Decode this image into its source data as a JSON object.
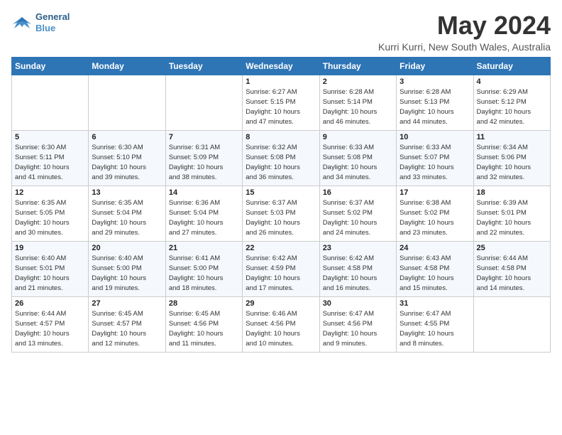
{
  "logo": {
    "line1": "General",
    "line2": "Blue"
  },
  "title": "May 2024",
  "location": "Kurri Kurri, New South Wales, Australia",
  "days_header": [
    "Sunday",
    "Monday",
    "Tuesday",
    "Wednesday",
    "Thursday",
    "Friday",
    "Saturday"
  ],
  "weeks": [
    [
      {
        "day": "",
        "info": ""
      },
      {
        "day": "",
        "info": ""
      },
      {
        "day": "",
        "info": ""
      },
      {
        "day": "1",
        "info": "Sunrise: 6:27 AM\nSunset: 5:15 PM\nDaylight: 10 hours\nand 47 minutes."
      },
      {
        "day": "2",
        "info": "Sunrise: 6:28 AM\nSunset: 5:14 PM\nDaylight: 10 hours\nand 46 minutes."
      },
      {
        "day": "3",
        "info": "Sunrise: 6:28 AM\nSunset: 5:13 PM\nDaylight: 10 hours\nand 44 minutes."
      },
      {
        "day": "4",
        "info": "Sunrise: 6:29 AM\nSunset: 5:12 PM\nDaylight: 10 hours\nand 42 minutes."
      }
    ],
    [
      {
        "day": "5",
        "info": "Sunrise: 6:30 AM\nSunset: 5:11 PM\nDaylight: 10 hours\nand 41 minutes."
      },
      {
        "day": "6",
        "info": "Sunrise: 6:30 AM\nSunset: 5:10 PM\nDaylight: 10 hours\nand 39 minutes."
      },
      {
        "day": "7",
        "info": "Sunrise: 6:31 AM\nSunset: 5:09 PM\nDaylight: 10 hours\nand 38 minutes."
      },
      {
        "day": "8",
        "info": "Sunrise: 6:32 AM\nSunset: 5:08 PM\nDaylight: 10 hours\nand 36 minutes."
      },
      {
        "day": "9",
        "info": "Sunrise: 6:33 AM\nSunset: 5:08 PM\nDaylight: 10 hours\nand 34 minutes."
      },
      {
        "day": "10",
        "info": "Sunrise: 6:33 AM\nSunset: 5:07 PM\nDaylight: 10 hours\nand 33 minutes."
      },
      {
        "day": "11",
        "info": "Sunrise: 6:34 AM\nSunset: 5:06 PM\nDaylight: 10 hours\nand 32 minutes."
      }
    ],
    [
      {
        "day": "12",
        "info": "Sunrise: 6:35 AM\nSunset: 5:05 PM\nDaylight: 10 hours\nand 30 minutes."
      },
      {
        "day": "13",
        "info": "Sunrise: 6:35 AM\nSunset: 5:04 PM\nDaylight: 10 hours\nand 29 minutes."
      },
      {
        "day": "14",
        "info": "Sunrise: 6:36 AM\nSunset: 5:04 PM\nDaylight: 10 hours\nand 27 minutes."
      },
      {
        "day": "15",
        "info": "Sunrise: 6:37 AM\nSunset: 5:03 PM\nDaylight: 10 hours\nand 26 minutes."
      },
      {
        "day": "16",
        "info": "Sunrise: 6:37 AM\nSunset: 5:02 PM\nDaylight: 10 hours\nand 24 minutes."
      },
      {
        "day": "17",
        "info": "Sunrise: 6:38 AM\nSunset: 5:02 PM\nDaylight: 10 hours\nand 23 minutes."
      },
      {
        "day": "18",
        "info": "Sunrise: 6:39 AM\nSunset: 5:01 PM\nDaylight: 10 hours\nand 22 minutes."
      }
    ],
    [
      {
        "day": "19",
        "info": "Sunrise: 6:40 AM\nSunset: 5:01 PM\nDaylight: 10 hours\nand 21 minutes."
      },
      {
        "day": "20",
        "info": "Sunrise: 6:40 AM\nSunset: 5:00 PM\nDaylight: 10 hours\nand 19 minutes."
      },
      {
        "day": "21",
        "info": "Sunrise: 6:41 AM\nSunset: 5:00 PM\nDaylight: 10 hours\nand 18 minutes."
      },
      {
        "day": "22",
        "info": "Sunrise: 6:42 AM\nSunset: 4:59 PM\nDaylight: 10 hours\nand 17 minutes."
      },
      {
        "day": "23",
        "info": "Sunrise: 6:42 AM\nSunset: 4:58 PM\nDaylight: 10 hours\nand 16 minutes."
      },
      {
        "day": "24",
        "info": "Sunrise: 6:43 AM\nSunset: 4:58 PM\nDaylight: 10 hours\nand 15 minutes."
      },
      {
        "day": "25",
        "info": "Sunrise: 6:44 AM\nSunset: 4:58 PM\nDaylight: 10 hours\nand 14 minutes."
      }
    ],
    [
      {
        "day": "26",
        "info": "Sunrise: 6:44 AM\nSunset: 4:57 PM\nDaylight: 10 hours\nand 13 minutes."
      },
      {
        "day": "27",
        "info": "Sunrise: 6:45 AM\nSunset: 4:57 PM\nDaylight: 10 hours\nand 12 minutes."
      },
      {
        "day": "28",
        "info": "Sunrise: 6:45 AM\nSunset: 4:56 PM\nDaylight: 10 hours\nand 11 minutes."
      },
      {
        "day": "29",
        "info": "Sunrise: 6:46 AM\nSunset: 4:56 PM\nDaylight: 10 hours\nand 10 minutes."
      },
      {
        "day": "30",
        "info": "Sunrise: 6:47 AM\nSunset: 4:56 PM\nDaylight: 10 hours\nand 9 minutes."
      },
      {
        "day": "31",
        "info": "Sunrise: 6:47 AM\nSunset: 4:55 PM\nDaylight: 10 hours\nand 8 minutes."
      },
      {
        "day": "",
        "info": ""
      }
    ]
  ]
}
